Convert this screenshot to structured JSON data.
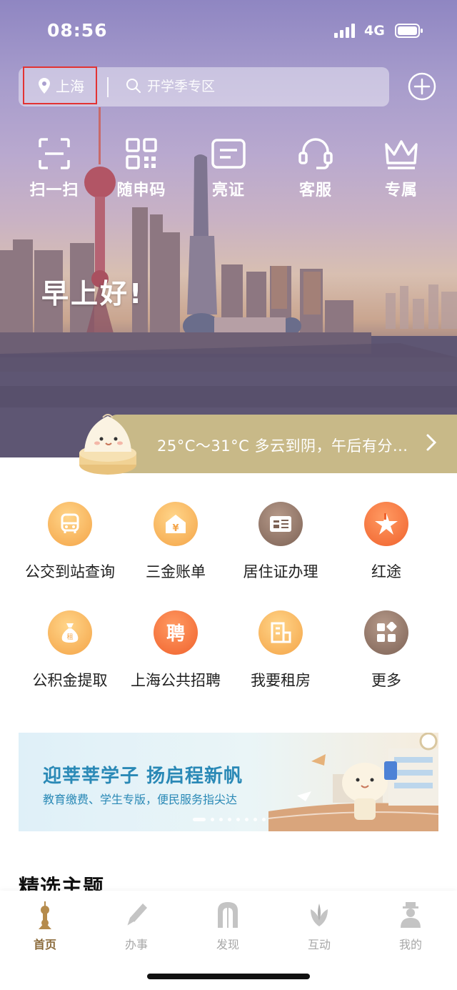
{
  "status_bar": {
    "time": "08:56",
    "network": "4G"
  },
  "header": {
    "location": "上海",
    "search_placeholder": "开学季专区"
  },
  "quick_actions": [
    {
      "label": "扫一扫",
      "icon": "scan-icon"
    },
    {
      "label": "随申码",
      "icon": "qr-code-icon"
    },
    {
      "label": "亮证",
      "icon": "id-card-icon"
    },
    {
      "label": "客服",
      "icon": "headset-icon"
    },
    {
      "label": "专属",
      "icon": "crown-icon"
    }
  ],
  "greeting": "早上好!",
  "weather": {
    "text": "25°C～31°C 多云到阴，午后有分..."
  },
  "services": [
    {
      "label": "公交到站查询",
      "icon": "bus-icon"
    },
    {
      "label": "三金账单",
      "icon": "bill-icon"
    },
    {
      "label": "居住证办理",
      "icon": "residence-permit-icon"
    },
    {
      "label": "红途",
      "icon": "red-star-icon"
    },
    {
      "label": "公积金提取",
      "icon": "fund-bag-icon"
    },
    {
      "label": "上海公共招聘",
      "icon": "recruit-icon"
    },
    {
      "label": "我要租房",
      "icon": "rent-icon"
    },
    {
      "label": "更多",
      "icon": "more-grid-icon"
    }
  ],
  "banner": {
    "title": "迎莘莘学子 扬启程新帆",
    "subtitle": "教育缴费、学生专版，便民服务指尖达",
    "slide_count": 8,
    "active_slide": 1
  },
  "section": {
    "title": "精选主题"
  },
  "tabbar": [
    {
      "label": "首页",
      "icon": "home-tower-icon",
      "active": true
    },
    {
      "label": "办事",
      "icon": "pen-icon",
      "active": false
    },
    {
      "label": "发现",
      "icon": "discover-arch-icon",
      "active": false
    },
    {
      "label": "互动",
      "icon": "lotus-icon",
      "active": false
    },
    {
      "label": "我的",
      "icon": "profile-icon",
      "active": false
    }
  ],
  "colors": {
    "weather_bar": "#c8b988",
    "banner_text": "#2a89b6",
    "tab_active": "#8a6a3a",
    "highlight_box": "#e23333"
  }
}
